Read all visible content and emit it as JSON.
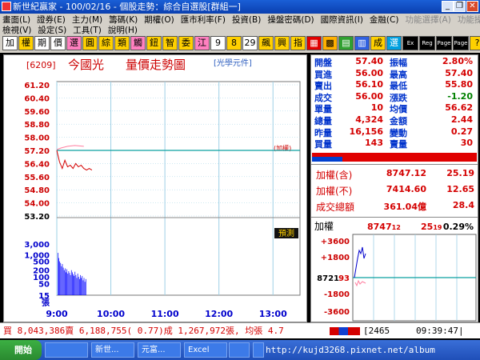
{
  "window": {
    "title": "新世紀贏家 - 100/02/16 - 個股走勢：綜合自選股[群組一]"
  },
  "menu": {
    "row1": [
      "畫面(L)",
      "證券(E)",
      "主力(M)",
      "籌碼(K)",
      "期權(O)",
      "匯市利率(F)",
      "投資(B)",
      "操盤密碼(D)",
      "國際資訊(I)",
      "金融(C)",
      "功能選擇(A)",
      "功能操作(T)"
    ],
    "row2": [
      "檢視(V)",
      "設定(S)",
      "工具(T)",
      "說明(H)"
    ]
  },
  "toolbar": {
    "buttons": [
      "加",
      "權",
      "期",
      "價",
      "選",
      "圓",
      "綜",
      "類",
      "觸",
      "鈕",
      "智",
      "委",
      "江",
      "9",
      "8",
      "29",
      "飆",
      "興",
      "指",
      "▦",
      "▩",
      "▤",
      "▥",
      "成",
      "選",
      "Ex",
      "Reg",
      "Page",
      "Page",
      "?"
    ]
  },
  "chart": {
    "code": "[6209]",
    "name": "今國光",
    "title": "量價走勢圖",
    "unit": "[光學元件]",
    "ref_note": "(加權)",
    "price_ticks": [
      "61.20",
      "60.40",
      "59.60",
      "58.80",
      "58.00",
      "57.20",
      "56.40",
      "55.60",
      "54.80",
      "54.00",
      "53.20"
    ],
    "volume_ticks": [
      "3,000",
      "1,000",
      "500",
      "200",
      "100",
      "50",
      "15",
      "張"
    ],
    "time_ticks": [
      "9:00",
      "10:00",
      "11:00",
      "12:00",
      "13:00"
    ],
    "badge": "預測"
  },
  "quote": {
    "rows": [
      {
        "l1": "開盤",
        "v1": "57.40",
        "l2": "振幅",
        "v2": "2.80%"
      },
      {
        "l1": "買進",
        "v1": "56.00",
        "l2": "最高",
        "v2": "57.40"
      },
      {
        "l1": "賣出",
        "v1": "56.10",
        "l2": "最低",
        "v2": "55.80"
      },
      {
        "l1": "成交",
        "v1": "56.00",
        "l2": "漲跌",
        "v2": "-1.20"
      },
      {
        "l1": "單量",
        "v1": "10",
        "l2": "均價",
        "v2": "56.62"
      },
      {
        "l1": "總量",
        "v1": "4,324",
        "l2": "金額",
        "v2": "2.44"
      },
      {
        "l1": "昨量",
        "v1": "16,156",
        "l2": "變動",
        "v2": "0.27"
      },
      {
        "l1": "買量",
        "v1": "143",
        "l2": "賣量",
        "v2": "30"
      }
    ],
    "index_rows": [
      {
        "label": "加權(含)",
        "value": "8747.12",
        "change": "25.19"
      },
      {
        "label": "加權(不)",
        "value": "7414.60",
        "change": "12.65"
      },
      {
        "label": "成交總額",
        "value": "361.04億",
        "change": "28.4"
      }
    ]
  },
  "mini": {
    "label": "加權",
    "value": "8747",
    "value_frac": "12",
    "change": "25",
    "change_frac": "19",
    "pct": "0.29%",
    "ticks": [
      "+3600",
      "+1800",
      "8721",
      "93",
      "-1800",
      "-3600"
    ]
  },
  "status": {
    "text": "買 8,043,386賣 6,188,755( 0.77)成 1,267,972張, 均張 4.7",
    "count": "2465",
    "clock": "09:39:47"
  },
  "taskbar": {
    "start": "開始",
    "tasks": [
      "",
      "新世...",
      "元富...",
      "Excel",
      "",
      "",
      ""
    ],
    "watermark": "http://kujd3268.pixnet.net/album"
  },
  "colors": {
    "up": "#d40000",
    "down": "#008000",
    "price_label": "#cc0000",
    "volume": "#0000ff",
    "grid": "#9ed0e6",
    "ref_line": "#0aa0a0"
  },
  "chart_data": {
    "type": "line",
    "title": "量價走勢圖",
    "xlabel": "",
    "ylabel": "",
    "x_range": [
      "9:00",
      "13:30"
    ],
    "ylim": [
      53.2,
      61.2
    ],
    "reference_price": 57.2,
    "series": [
      {
        "values": [
          {
            "t": "9:00",
            "y": 57.2
          },
          {
            "t": "9:03",
            "y": 56.5
          },
          {
            "t": "9:06",
            "y": 56.1
          },
          {
            "t": "9:09",
            "y": 56.6
          },
          {
            "t": "9:12",
            "y": 56.2
          },
          {
            "t": "9:15",
            "y": 56.3
          },
          {
            "t": "9:18",
            "y": 56.1
          },
          {
            "t": "9:21",
            "y": 56.4
          },
          {
            "t": "9:24",
            "y": 56.2
          },
          {
            "t": "9:27",
            "y": 56.3
          },
          {
            "t": "9:30",
            "y": 56.1
          },
          {
            "t": "9:33",
            "y": 56.0
          },
          {
            "t": "9:36",
            "y": 56.1
          },
          {
            "t": "9:39",
            "y": 56.0
          }
        ]
      }
    ],
    "volume": {
      "unit": "張",
      "scale": "log",
      "ticks": [
        15,
        50,
        100,
        200,
        500,
        1000,
        3000
      ],
      "bars": [
        1200,
        700,
        500,
        420,
        300,
        380,
        260,
        200,
        240,
        160,
        220,
        140,
        180,
        150,
        120,
        200,
        160,
        130,
        110,
        170,
        120,
        90,
        140,
        100,
        80,
        120,
        90,
        110,
        70,
        90,
        60,
        80
      ]
    }
  }
}
